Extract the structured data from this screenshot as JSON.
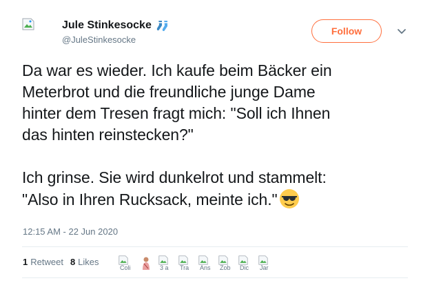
{
  "author": {
    "display_name": "Jule Stinkesocke",
    "handle": "@JuleStinkesocke",
    "name_emoji": "socks-icon"
  },
  "follow_button": {
    "label": "Follow",
    "accent": "#ff6e3c"
  },
  "tweet": {
    "text_lines": [
      "Da war es wieder. Ich kaufe beim Bäcker ein",
      "Meterbrot und die freundliche junge Dame",
      "hinter dem Tresen fragt mich: \"Soll ich Ihnen",
      "das hinten reinstecken?\"",
      "",
      "Ich grinse. Sie wird dunkelrot und stammelt:",
      "\"Also in Ihren Rucksack, meinte ich.\""
    ],
    "trailing_emoji": "sunglasses-face-icon",
    "timestamp": "12:15 AM - 22 Jun 2020"
  },
  "stats": {
    "retweet_count": "1",
    "retweet_label": "Retweet",
    "like_count": "8",
    "like_label": "Likes"
  },
  "likers": [
    {
      "caption": "Coli"
    },
    {
      "caption": ""
    },
    {
      "caption": "3 a"
    },
    {
      "caption": "Tra"
    },
    {
      "caption": "Ans"
    },
    {
      "caption": "Zob"
    },
    {
      "caption": "Dic"
    },
    {
      "caption": "Jar"
    }
  ],
  "colors": {
    "text": "#14171a",
    "secondary": "#657786",
    "divider": "#e6ecf0"
  }
}
